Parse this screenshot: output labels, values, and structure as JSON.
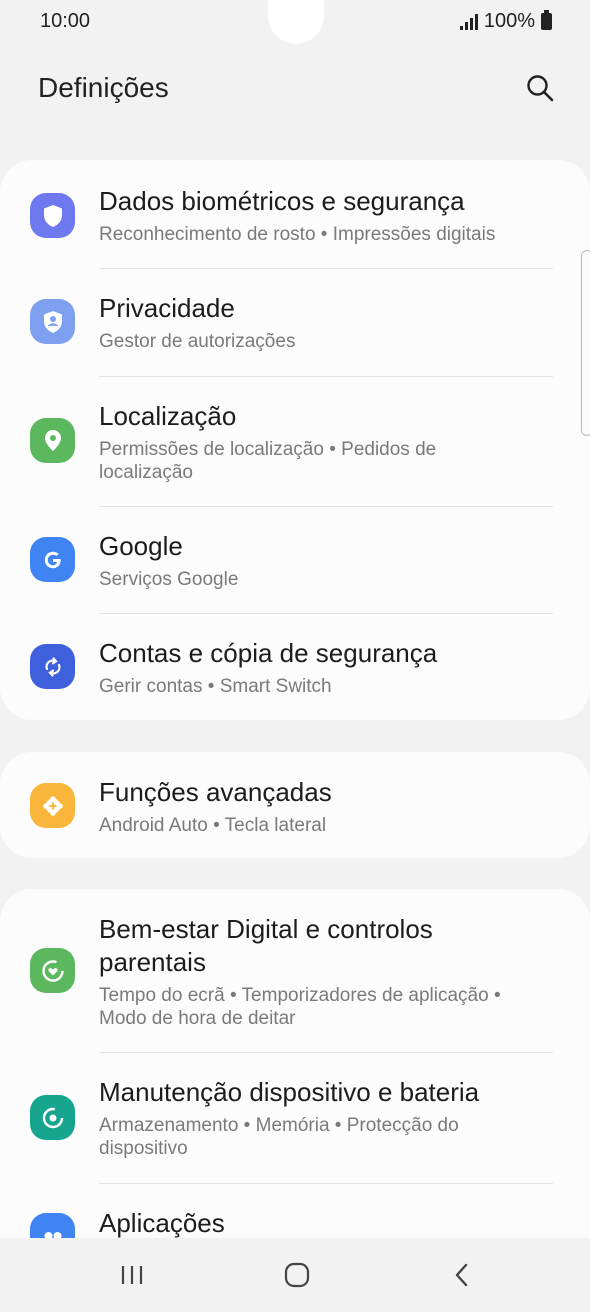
{
  "status_bar": {
    "time": "10:00",
    "battery_text": "100%",
    "signal_icon": "signal-icon",
    "battery_icon": "battery-icon"
  },
  "header": {
    "title": "Definições",
    "search_icon": "search-icon"
  },
  "cards": [
    {
      "items": [
        {
          "title": "Dados biométricos e segurança",
          "subtitle": "Reconhecimento de rosto  •  Impressões digitais",
          "icon": "shield-icon",
          "color": "#6e79f0"
        },
        {
          "title": "Privacidade",
          "subtitle": "Gestor de autorizações",
          "icon": "privacy-icon",
          "color": "#7da0f0"
        },
        {
          "title": "Localização",
          "subtitle": "Permissões de localização  •  Pedidos de localização",
          "icon": "location-pin-icon",
          "color": "#5cb85f"
        },
        {
          "title": "Google",
          "subtitle": "Serviços Google",
          "icon": "google-icon",
          "color": "#3f84f2"
        },
        {
          "title": "Contas e cópia de segurança",
          "subtitle": "Gerir contas  •  Smart Switch",
          "icon": "sync-icon",
          "color": "#3f60dd"
        }
      ]
    },
    {
      "items": [
        {
          "title": "Funções avançadas",
          "subtitle": "Android Auto  •  Tecla lateral",
          "icon": "gear-plus-icon",
          "color": "#f9b63a"
        }
      ]
    },
    {
      "items": [
        {
          "title": "Bem-estar Digital e controlos parentais",
          "subtitle": "Tempo do ecrã  •  Temporizadores de aplicação  •  Modo de hora de deitar",
          "icon": "wellbeing-icon",
          "color": "#5cb85f"
        },
        {
          "title": "Manutenção dispositivo e bateria",
          "subtitle": "Armazenamento  •  Memória  •  Protecção do dispositivo",
          "icon": "device-care-icon",
          "color": "#17a58f"
        },
        {
          "title": "Aplicações",
          "subtitle": "",
          "icon": "apps-icon",
          "color": "#3f84f2"
        }
      ]
    }
  ],
  "nav_bar": {
    "recents_icon": "recents-icon",
    "home_icon": "home-icon",
    "back_icon": "back-icon"
  },
  "colors": {
    "background": "#f2f2f2",
    "card": "#fcfcfc",
    "subtitle": "#7a7a7a"
  }
}
